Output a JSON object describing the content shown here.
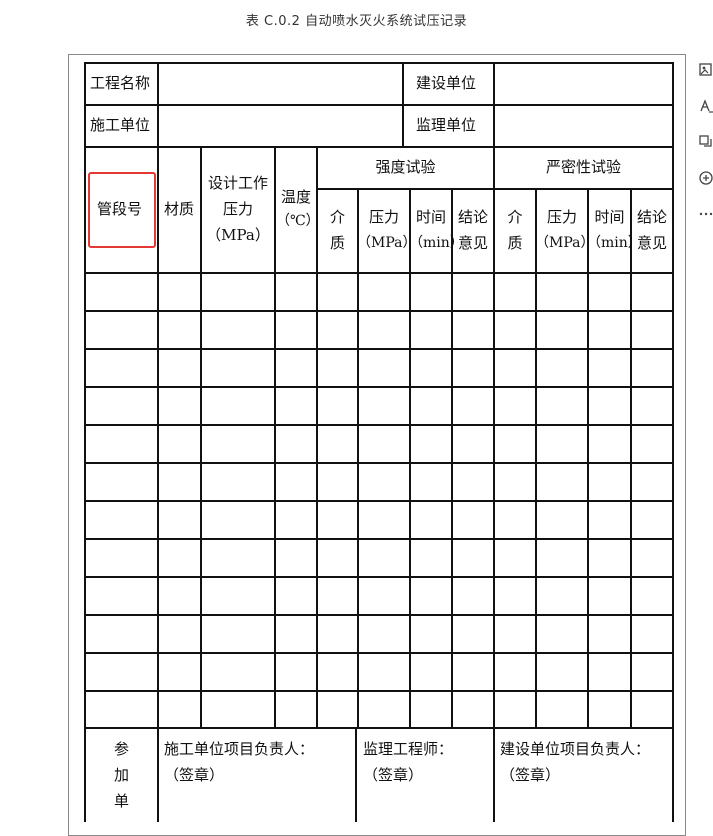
{
  "title": "表 C.0.2 自动喷水灭火系统试压记录",
  "header": {
    "project_name": "工程名称",
    "construction_unit": "建设单位",
    "builder_unit": "施工单位",
    "supervision_unit": "监理单位"
  },
  "columns": {
    "pipe_section": "管段号",
    "material": "材质",
    "design_pressure": [
      "设计工作",
      "压力",
      "（MPa）"
    ],
    "temperature": [
      "温度",
      "（℃）"
    ],
    "strength_test": "强度试验",
    "tightness_test": "严密性试验",
    "medium": [
      "介",
      "质"
    ],
    "pressure": [
      "压力",
      "（MPa）"
    ],
    "time": [
      "时间",
      "（min）"
    ],
    "conclusion": [
      "结论",
      "意见"
    ]
  },
  "footer": {
    "participants": [
      "参",
      "加",
      "单"
    ],
    "builder_manager": "施工单位项目负责人：",
    "supervisor": "监理工程师：",
    "owner_manager": "建设单位项目负责人：",
    "seal": "（签章）"
  },
  "toolbar": [
    "image-search-icon",
    "text-icon",
    "screenshot-icon",
    "add-icon",
    "more-icon"
  ]
}
